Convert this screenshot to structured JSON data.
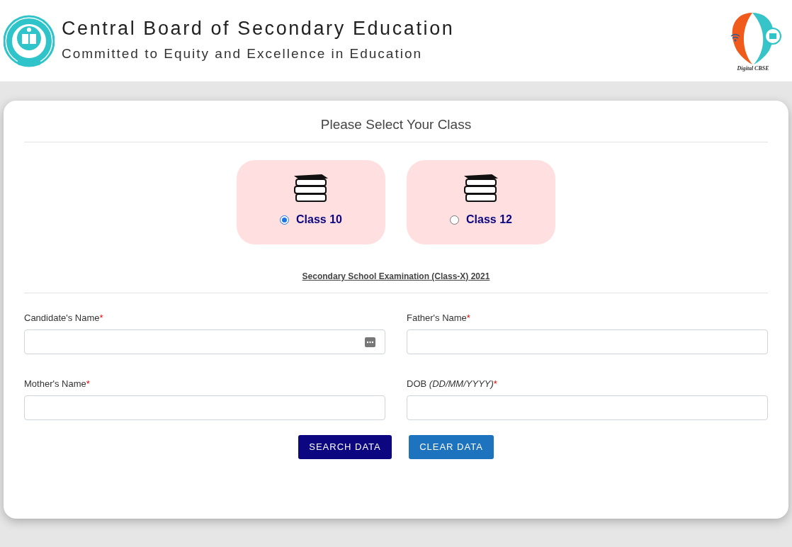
{
  "header": {
    "title": "Central Board of Secondary Education",
    "subtitle": "Committed to Equity and Excellence in Education",
    "logo_caption": "Digital CBSE"
  },
  "form": {
    "title": "Please Select Your Class",
    "classes": [
      {
        "label": "Class 10",
        "selected": true
      },
      {
        "label": "Class 12",
        "selected": false
      }
    ],
    "exam_caption": "Secondary School Examination (Class-X) 2021",
    "fields": [
      {
        "label": "Candidate's Name",
        "required_mark": "*",
        "autofill_icon": true
      },
      {
        "label": "Father's Name",
        "required_mark": "*",
        "autofill_icon": false
      },
      {
        "label": "Mother's Name",
        "required_mark": "*",
        "autofill_icon": false
      },
      {
        "label": "DOB *(DD/MM/YYYY)*",
        "required_mark": "*",
        "autofill_icon": false
      }
    ],
    "buttons": [
      {
        "label": "SEARCH DATA",
        "kind": "primary"
      },
      {
        "label": "CLEAR DATA",
        "kind": "secondary"
      }
    ]
  }
}
